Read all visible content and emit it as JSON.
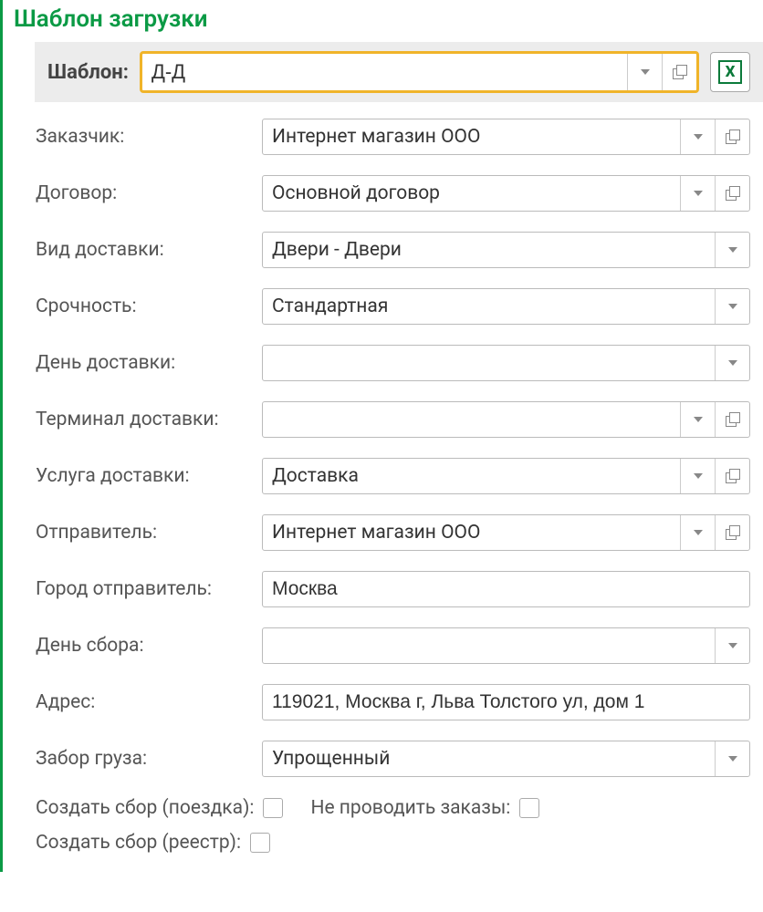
{
  "title": "Шаблон загрузки",
  "template": {
    "label": "Шаблон:",
    "value": "Д-Д"
  },
  "fields": {
    "customer": {
      "label": "Заказчик:",
      "value": "Интернет магазин ООО"
    },
    "contract": {
      "label": "Договор:",
      "value": "Основной договор"
    },
    "delivery_type": {
      "label": "Вид доставки:",
      "value": "Двери - Двери"
    },
    "urgency": {
      "label": "Срочность:",
      "value": "Стандартная"
    },
    "delivery_day": {
      "label": "День доставки:",
      "value": ""
    },
    "delivery_terminal": {
      "label": "Терминал доставки:",
      "value": ""
    },
    "delivery_service": {
      "label": "Услуга доставки:",
      "value": "Доставка"
    },
    "sender": {
      "label": "Отправитель:",
      "value": "Интернет магазин ООО"
    },
    "sender_city": {
      "label": "Город отправитель:",
      "value": "Москва"
    },
    "pickup_day": {
      "label": "День сбора:",
      "value": ""
    },
    "address": {
      "label": "Адрес:",
      "value": "119021, Москва г, Льва Толстого ул, дом 1"
    },
    "pickup_type": {
      "label": "Забор груза:",
      "value": "Упрощенный"
    }
  },
  "checks": {
    "create_trip": "Создать сбор (поездка):",
    "no_post": "Не проводить заказы:",
    "create_reg": "Создать сбор (реестр):"
  },
  "excel_letter": "X"
}
